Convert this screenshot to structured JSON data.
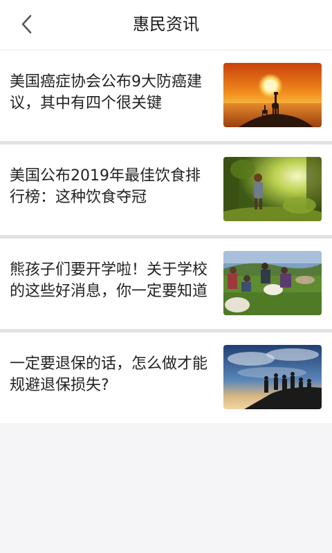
{
  "header": {
    "title": "惠民资讯",
    "back_icon": "chevron-left-icon"
  },
  "colors": {
    "page_background": "#f5f4f7",
    "card_background": "#ffffff",
    "separator": "#e2e1e5"
  },
  "news": [
    {
      "title": "美国癌症协会公布9大防癌建议，其中有四个很关键",
      "image": "sunset-giraffes-photo"
    },
    {
      "title": "美国公布2019年最佳饮食排行榜：这种饮食夺冠",
      "image": "forest-child-photo"
    },
    {
      "title": "熊孩子们要开学啦！关于学校的这些好消息，你一定要知道",
      "image": "sheep-shearing-photo"
    },
    {
      "title": "一定要退保的话，怎么做才能规避退保损失?",
      "image": "hikers-silhouette-photo"
    }
  ]
}
